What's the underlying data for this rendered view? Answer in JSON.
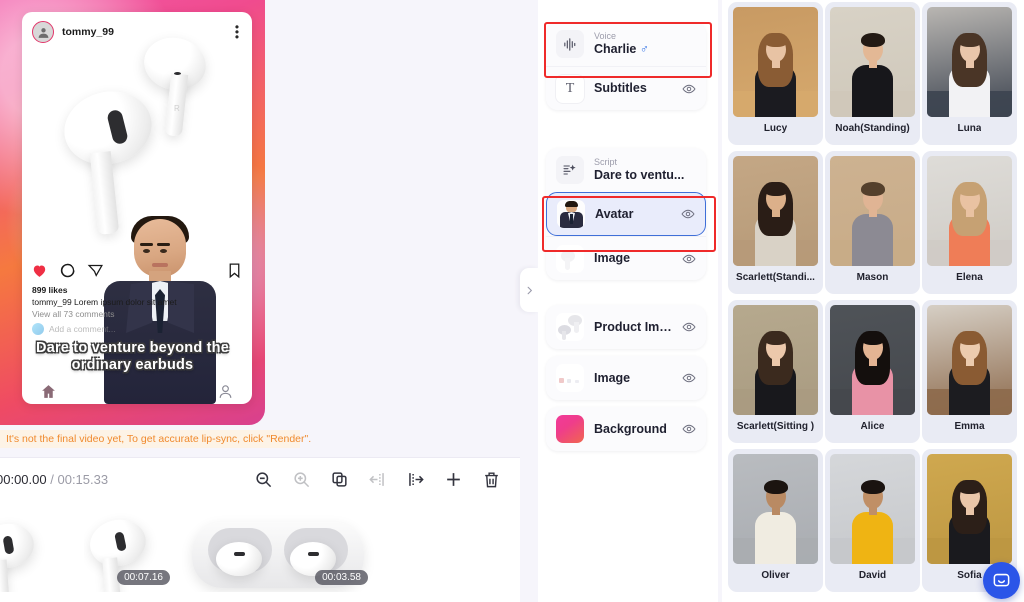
{
  "preview": {
    "post_username": "tommy_99",
    "likes_text": "899 likes",
    "caption_line": "tommy_99  Lorem ipsum dolor sit amet",
    "comments_text": "View all 73 comments",
    "add_comment_placeholder": "Add a comment...",
    "subtitle_overlay": "Dare to venture beyond the ordinary earbuds",
    "render_hint": "It's not the final video yet, To get accurate lip-sync, click \"Render\".",
    "more_icon": "more-options-icon",
    "like_icon": "heart-icon",
    "comment_icon": "comment-icon",
    "share_icon": "share-icon",
    "bookmark_icon": "bookmark-icon",
    "home_icon": "home-icon",
    "profile_icon": "profile-icon"
  },
  "toolbar": {
    "current_time": "00:00.00",
    "separator": "/",
    "total_time": "00:15.33",
    "buttons": [
      {
        "name": "zoom-out-icon",
        "label": "Zoom out",
        "enabled": true
      },
      {
        "name": "zoom-in-icon",
        "label": "Zoom in",
        "enabled": false
      },
      {
        "name": "duplicate-icon",
        "label": "Duplicate",
        "enabled": true
      },
      {
        "name": "split-left-icon",
        "label": "Split left",
        "enabled": false
      },
      {
        "name": "split-right-icon",
        "label": "Split right",
        "enabled": true
      },
      {
        "name": "add-icon",
        "label": "Add",
        "enabled": true
      },
      {
        "name": "delete-icon",
        "label": "Delete",
        "enabled": true
      }
    ]
  },
  "timeline": {
    "clips": [
      {
        "name": "clip-1",
        "duration": ""
      },
      {
        "name": "clip-2",
        "duration": "00:07.16"
      },
      {
        "name": "clip-3",
        "duration": "00:03.58"
      }
    ]
  },
  "layers": {
    "groups": [
      {
        "name": "group-voice-subtitles",
        "items": [
          {
            "id": "voice",
            "sub": "Voice",
            "title": "Charlie",
            "gender": "♂",
            "icon": "waveform-icon",
            "eye": false,
            "highlighted": true,
            "selected": false
          },
          {
            "id": "subtitles",
            "sub": "",
            "title": "Subtitles",
            "gender": "",
            "icon": "text-t-icon",
            "eye": true,
            "highlighted": false,
            "selected": false
          }
        ]
      },
      {
        "name": "group-script-avatar-image",
        "items": [
          {
            "id": "script",
            "sub": "Script",
            "title": "Dare to ventu...",
            "gender": "",
            "icon": "script-icon",
            "eye": false,
            "highlighted": false,
            "selected": false
          },
          {
            "id": "avatar",
            "sub": "",
            "title": "Avatar",
            "gender": "",
            "icon": "avatar-thumb-icon",
            "eye": true,
            "highlighted": true,
            "selected": true
          },
          {
            "id": "image-1",
            "sub": "",
            "title": "Image",
            "gender": "",
            "icon": "image-thumb-icon",
            "eye": true,
            "highlighted": false,
            "selected": false
          }
        ]
      },
      {
        "name": "group-product-image",
        "items": [
          {
            "id": "product-image",
            "sub": "",
            "title": "Product Image",
            "gender": "",
            "icon": "earbuds-thumb-icon",
            "eye": true,
            "highlighted": false,
            "selected": false
          }
        ]
      },
      {
        "name": "group-image-2",
        "items": [
          {
            "id": "image-2",
            "sub": "",
            "title": "Image",
            "gender": "",
            "icon": "image-thumb-icon",
            "eye": true,
            "highlighted": false,
            "selected": false
          }
        ]
      },
      {
        "name": "group-background",
        "items": [
          {
            "id": "background",
            "sub": "",
            "title": "Background",
            "gender": "",
            "icon": "gradient-swatch-icon",
            "eye": true,
            "highlighted": false,
            "selected": false
          }
        ]
      }
    ],
    "collapse_icon": "chevron-right-icon"
  },
  "avatars": {
    "cards": [
      {
        "name": "Lucy",
        "bg": "#c89a63",
        "skin": "#e8c3a4",
        "hair": "#8a5c34",
        "cloth": "#1b1b20",
        "long_hair": true,
        "seat": "#d6a96d"
      },
      {
        "name": "Noah(Standing)",
        "bg": "#d8d2c6",
        "skin": "#e3b895",
        "hair": "#231a14",
        "cloth": "#17171b",
        "long_hair": false,
        "seat": "#cfc8ba"
      },
      {
        "name": "Luna",
        "bg": "#b9b6b2",
        "skin": "#e9c6ab",
        "hair": "#4a3526",
        "cloth": "#f2f2f4",
        "long_hair": true,
        "seat": "#3d4450"
      },
      {
        "name": "Scarlett(Standi...",
        "bg": "#c4a785",
        "skin": "#dcb08a",
        "hair": "#2a1d16",
        "cloth": "#d9d2c6",
        "long_hair": true,
        "seat": "#b69a78"
      },
      {
        "name": "Mason",
        "bg": "#cdb291",
        "skin": "#e0b494",
        "hair": "#54402c",
        "cloth": "#8c8a93",
        "long_hair": false,
        "seat": "#c8ab87"
      },
      {
        "name": "Elena",
        "bg": "#dedcd8",
        "skin": "#e9c2a2",
        "hair": "#c6a173",
        "cloth": "#ef7d57",
        "long_hair": true,
        "seat": "#cfcbc5"
      },
      {
        "name": "Scarlett(Sitting )",
        "bg": "#b6a98e",
        "skin": "#ecc8ab",
        "hair": "#3b2a1e",
        "cloth": "#18181c",
        "long_hair": true,
        "seat": "#a99b81"
      },
      {
        "name": "Alice",
        "bg": "#4f5358",
        "skin": "#e3b493",
        "hair": "#140f0d",
        "cloth": "#e892a6",
        "long_hair": true,
        "seat": "#45484d"
      },
      {
        "name": "Emma",
        "bg": "#d6cfc5",
        "skin": "#eccbae",
        "hair": "#8a5b33",
        "cloth": "#1c1c20",
        "long_hair": true,
        "seat": "#8d6a4c"
      },
      {
        "name": "Oliver",
        "bg": "#b9bcc0",
        "skin": "#b98a63",
        "hair": "#1b1410",
        "cloth": "#f0ece1",
        "long_hair": false,
        "seat": "#a9acb1"
      },
      {
        "name": "David",
        "bg": "#d5d7da",
        "skin": "#c08f66",
        "hair": "#1a1310",
        "cloth": "#efb413",
        "long_hair": false,
        "seat": "#c6c8cb"
      },
      {
        "name": "Sofia",
        "bg": "#cfa84f",
        "skin": "#eac6a9",
        "hair": "#2c1f18",
        "cloth": "#1a1a1e",
        "long_hair": true,
        "seat": "#bd9742"
      }
    ]
  },
  "chat": {
    "icon": "chat-bubble-icon",
    "label": "Support chat"
  }
}
